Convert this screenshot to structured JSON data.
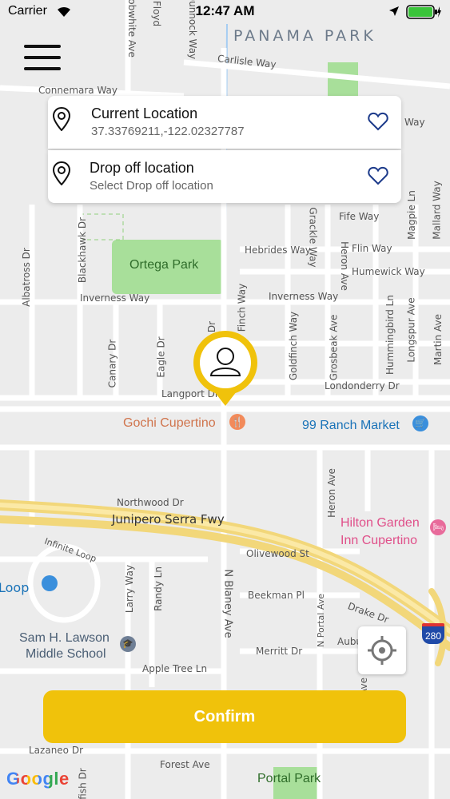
{
  "status_bar": {
    "carrier": "Carrier",
    "time": "12:47 AM"
  },
  "location_card": {
    "current_title": "Current Location",
    "current_coords": "37.33769211,-122.02327787",
    "dropoff_title": "Drop off location",
    "dropoff_placeholder": "Select Drop off location"
  },
  "map": {
    "area_label": "PANAMA PARK",
    "roads": [
      "Carlisle Way",
      "Connemara Way",
      "Way",
      "Fife Way",
      "Flin Way",
      "Humewick Way",
      "Hebrides Way",
      "Inverness Way",
      "Inverness Way",
      "Londonderry Dr",
      "Langport Dr",
      "Northwood Dr",
      "Junipero Serra Fwy",
      "Olivewood St",
      "Beekman Pl",
      "Merritt Dr",
      "Apple Tree Ln",
      "Lazaneo Dr",
      "Forest Ave",
      "N Blaney Ave",
      "Heron Ave",
      "Drake Dr",
      "Aubu",
      "Infinite Loop",
      "Loop",
      "Blackhawk Dr",
      "Albatross Dr",
      "Canary Dr",
      "Eagle Dr",
      "Finch Way",
      "Goldfinch Way",
      "Grosbeak Ave",
      "Heron Ave",
      "Hummingbird Ln",
      "Longspur Ave",
      "Martin Ave",
      "Magpie Ln",
      "Mallard Way",
      "Grackle Way",
      "Larry Way",
      "Randy Ln",
      "N Portal Ave",
      "Floyd",
      "Dunnock Way",
      "Bobwhite Ave",
      "Dr",
      "fish Dr",
      "Ave"
    ],
    "pois": {
      "ortega_park": "Ortega Park",
      "gochi": "Gochi Cupertino",
      "ranch_market": "99 Ranch Market",
      "hilton_line1": "Hilton Garden",
      "hilton_line2": "Inn Cupertino",
      "lawson_line1": "Sam H. Lawson",
      "lawson_line2": "Middle School",
      "portal_park": "Portal Park",
      "freeway_shield": "280"
    },
    "google_logo": "Google"
  },
  "actions": {
    "confirm_label": "Confirm"
  },
  "colors": {
    "accent": "#f0c20b",
    "heart": "#1c3a8a",
    "park": "#a8df9a",
    "water": "#b8d4f0"
  },
  "icons": [
    "menu-icon",
    "wifi-icon",
    "location-arrow-icon",
    "battery-icon",
    "pin-icon",
    "heart-icon",
    "user-marker-icon",
    "locate-icon",
    "restaurant-icon",
    "shopping-cart-icon",
    "hotel-icon",
    "school-icon"
  ]
}
